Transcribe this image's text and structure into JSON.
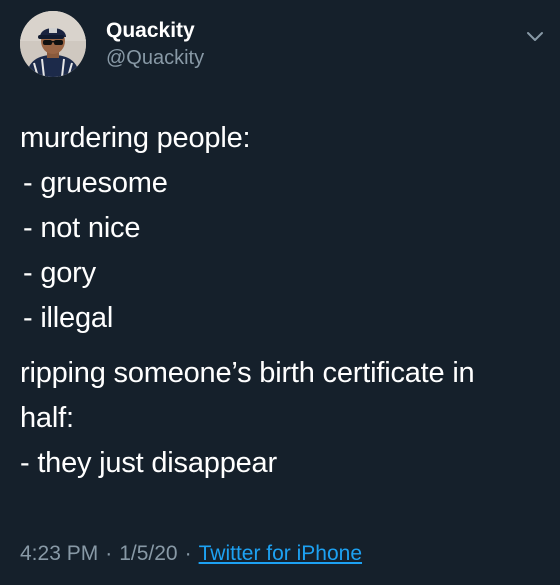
{
  "author": {
    "display_name": "Quackity",
    "handle": "@Quackity",
    "avatar_icon": "profile-photo"
  },
  "menu_icon": "chevron-down-icon",
  "tweet": {
    "paragraphs": [
      {
        "lines": [
          "murdering people:",
          " - gruesome",
          " - not nice",
          " - gory",
          " - illegal"
        ]
      },
      {
        "lines": [
          "ripping someone’s birth certificate in",
          "half:",
          "- they just disappear"
        ]
      }
    ]
  },
  "meta": {
    "time": "4:23 PM",
    "date": "1/5/20",
    "separator": "·",
    "source": "Twitter for iPhone"
  },
  "colors": {
    "background": "#15202b",
    "text": "#ffffff",
    "secondary_text": "#8899a6",
    "link": "#1da1f2"
  }
}
